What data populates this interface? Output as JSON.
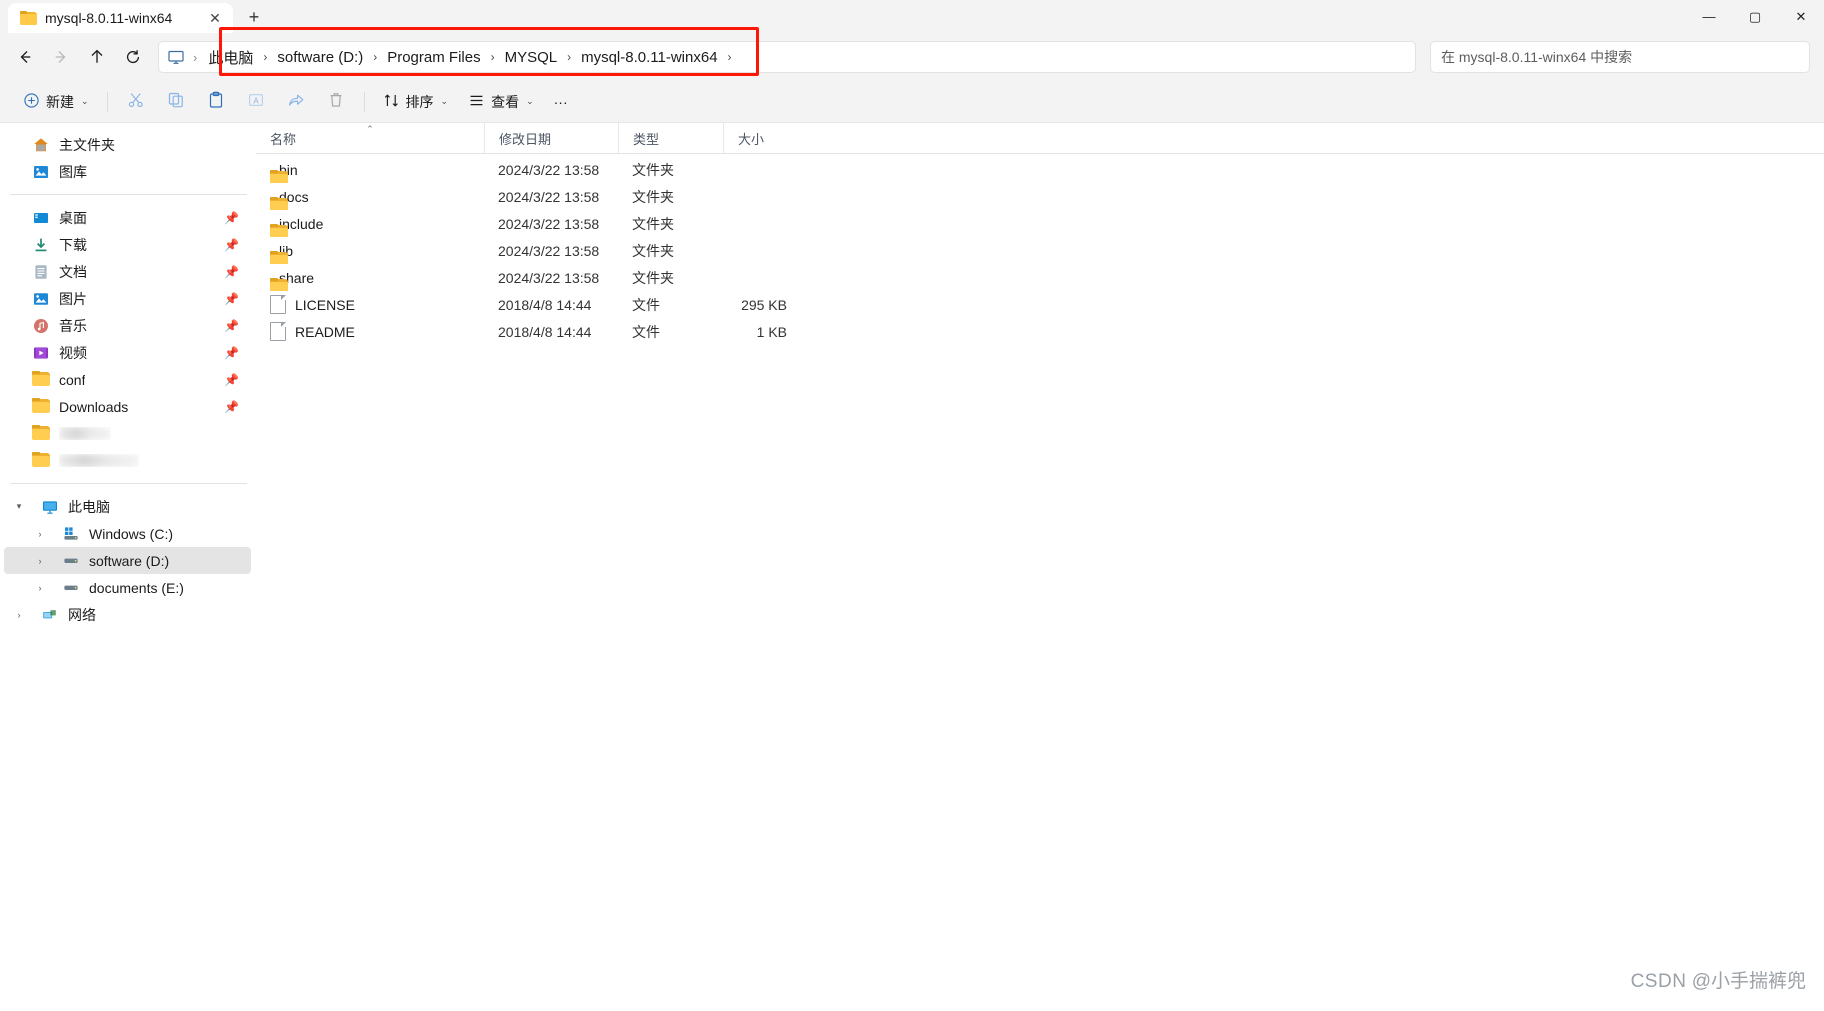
{
  "window": {
    "tab_title": "mysql-8.0.11-winx64",
    "tab_close": "✕",
    "new_tab": "+",
    "minimize": "—",
    "maximize": "▢",
    "close": "✕"
  },
  "nav": {
    "back": "back-arrow",
    "forward": "forward-arrow",
    "up": "up-arrow",
    "refresh": "refresh-arrow",
    "pc_icon": "this-pc-icon",
    "crumb_sep_small": "›",
    "breadcrumbs": [
      {
        "label": "此电脑"
      },
      {
        "label": "software (D:)"
      },
      {
        "label": "Program Files"
      },
      {
        "label": "MYSQL"
      },
      {
        "label": "mysql-8.0.11-winx64"
      }
    ],
    "separator": "›",
    "trailing_separator": "›",
    "search_placeholder": "在 mysql-8.0.11-winx64 中搜索"
  },
  "toolbar": {
    "new_label": "新建",
    "new_icon": "plus-circle-icon",
    "cut_icon": "scissors-icon",
    "copy_icon": "copy-icon",
    "paste_icon": "paste-icon",
    "rename_icon": "rename-icon",
    "share_icon": "share-icon",
    "delete_icon": "trash-icon",
    "sort_label": "排序",
    "sort_icon": "sort-arrows-icon",
    "view_label": "查看",
    "view_icon": "view-list-icon",
    "more_label": "···",
    "chevron": "⌄"
  },
  "sidebar": {
    "groups": [
      {
        "items": [
          {
            "label": "主文件夹",
            "icon": "home-icon",
            "pinned": false,
            "blurred": false,
            "expandable": false
          },
          {
            "label": "图库",
            "icon": "gallery-icon",
            "pinned": false,
            "blurred": false,
            "expandable": false
          }
        ]
      },
      {
        "items": [
          {
            "label": "桌面",
            "icon": "desktop-icon",
            "pinned": true,
            "blurred": false,
            "expandable": false
          },
          {
            "label": "下载",
            "icon": "downloads-icon",
            "pinned": true,
            "blurred": false,
            "expandable": false
          },
          {
            "label": "文档",
            "icon": "documents-icon",
            "pinned": true,
            "blurred": false,
            "expandable": false
          },
          {
            "label": "图片",
            "icon": "pictures-icon",
            "pinned": true,
            "blurred": false,
            "expandable": false
          },
          {
            "label": "音乐",
            "icon": "music-icon",
            "pinned": true,
            "blurred": false,
            "expandable": false
          },
          {
            "label": "视频",
            "icon": "videos-icon",
            "pinned": true,
            "blurred": false,
            "expandable": false
          },
          {
            "label": "conf",
            "icon": "folder-icon",
            "pinned": true,
            "blurred": false,
            "expandable": false
          },
          {
            "label": "Downloads",
            "icon": "folder-icon",
            "pinned": true,
            "blurred": false,
            "expandable": false
          },
          {
            "label": "",
            "icon": "folder-icon",
            "pinned": false,
            "blurred": true,
            "expandable": false
          },
          {
            "label": "",
            "icon": "folder-icon",
            "pinned": false,
            "blurred": true,
            "expandable": false
          }
        ]
      },
      {
        "items": [
          {
            "label": "此电脑",
            "icon": "this-pc-icon",
            "pinned": false,
            "blurred": false,
            "expandable": true,
            "expanded": true,
            "indent": 0
          },
          {
            "label": "Windows (C:)",
            "icon": "windows-drive-icon",
            "pinned": false,
            "blurred": false,
            "expandable": true,
            "expanded": false,
            "indent": 1
          },
          {
            "label": "software (D:)",
            "icon": "drive-icon",
            "pinned": false,
            "blurred": false,
            "expandable": true,
            "expanded": false,
            "indent": 1,
            "selected": true
          },
          {
            "label": "documents (E:)",
            "icon": "drive-icon",
            "pinned": false,
            "blurred": false,
            "expandable": true,
            "expanded": false,
            "indent": 1
          },
          {
            "label": "网络",
            "icon": "network-icon",
            "pinned": false,
            "blurred": false,
            "expandable": true,
            "expanded": false,
            "indent": 0
          }
        ]
      }
    ]
  },
  "filelist": {
    "columns": {
      "name": "名称",
      "date": "修改日期",
      "type": "类型",
      "size": "大小"
    },
    "sort_caret": "⌃",
    "rows": [
      {
        "name": "bin",
        "date": "2024/3/22 13:58",
        "type": "文件夹",
        "size": "",
        "icon": "folder-icon"
      },
      {
        "name": "docs",
        "date": "2024/3/22 13:58",
        "type": "文件夹",
        "size": "",
        "icon": "folder-icon"
      },
      {
        "name": "include",
        "date": "2024/3/22 13:58",
        "type": "文件夹",
        "size": "",
        "icon": "folder-icon"
      },
      {
        "name": "lib",
        "date": "2024/3/22 13:58",
        "type": "文件夹",
        "size": "",
        "icon": "folder-icon"
      },
      {
        "name": "share",
        "date": "2024/3/22 13:58",
        "type": "文件夹",
        "size": "",
        "icon": "folder-icon"
      },
      {
        "name": "LICENSE",
        "date": "2018/4/8 14:44",
        "type": "文件",
        "size": "295 KB",
        "icon": "file-icon"
      },
      {
        "name": "README",
        "date": "2018/4/8 14:44",
        "type": "文件",
        "size": "1 KB",
        "icon": "file-icon"
      }
    ]
  },
  "watermark": {
    "prefix": "CSDN",
    "author": "@小手揣裤兜"
  },
  "colors": {
    "annotation": "#fc1707",
    "folder": "#ffcd4f",
    "chrome": "#f3f3f3",
    "selection": "#e4e4e4"
  }
}
